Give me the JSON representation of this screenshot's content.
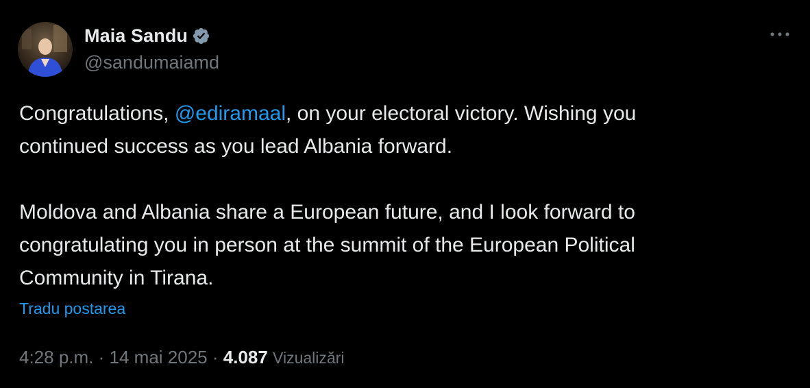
{
  "author": {
    "display_name": "Maia Sandu",
    "handle": "@sandumaiamd",
    "verified_icon": "verified-badge-icon",
    "avatar_icon": "profile-photo"
  },
  "post": {
    "line1_before": "Congratulations, ",
    "mention": "@ediramaal",
    "line1_after": ", on your electoral victory. Wishing you\ncontinued success as you lead Albania forward.\n\nMoldova and Albania share a European future, and I look forward to\ncongratulating you in person at the summit of the European Political\nCommunity in Tirana.",
    "translate_label": "Tradu postarea"
  },
  "meta": {
    "time": "4:28 p.m.",
    "separator": " · ",
    "date": "14 mai 2025",
    "views_count": "4.087",
    "views_label": "Vizualizări"
  },
  "colors": {
    "background": "#000000",
    "text": "#e7e9ea",
    "secondary": "#71767b",
    "accent": "#1d9bf0",
    "verified": "#829aab"
  }
}
